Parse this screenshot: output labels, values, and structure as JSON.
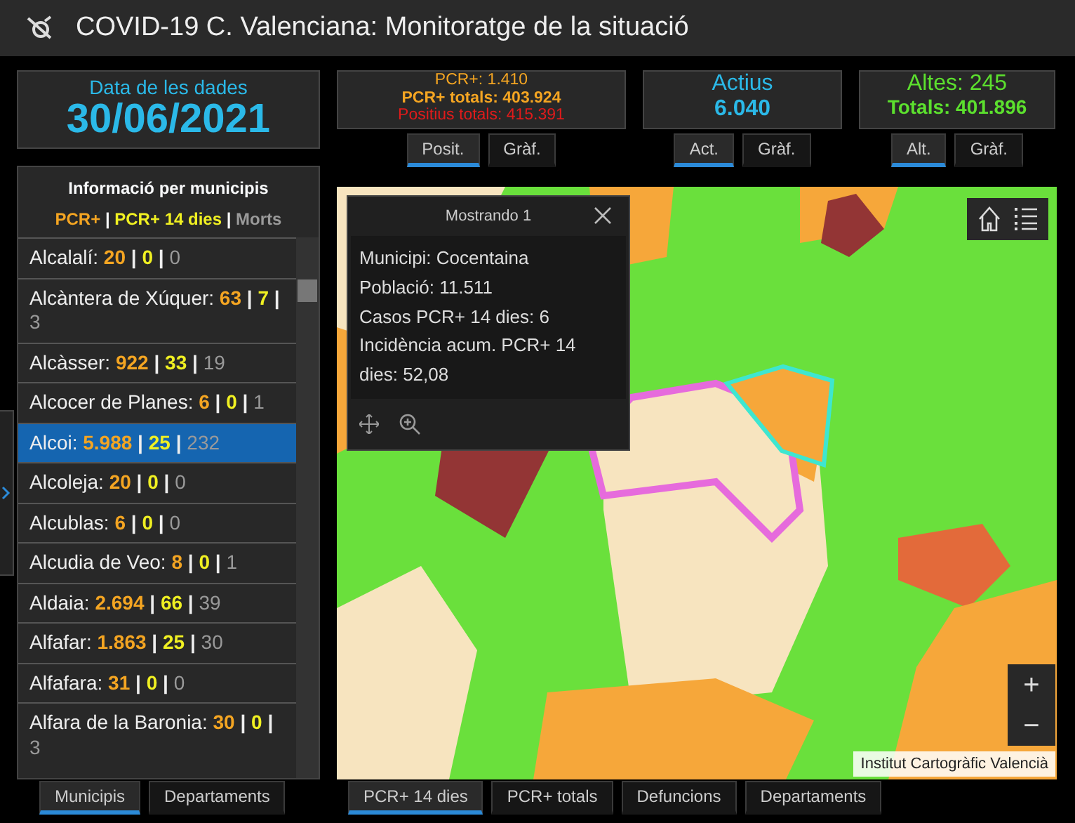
{
  "header": {
    "title": "COVID-19 C. Valenciana: Monitoratge de la situació"
  },
  "date_card": {
    "label": "Data de les dades",
    "value": "30/06/2021"
  },
  "pcr_card": {
    "lines": [
      {
        "text": "PCR+: 1.410",
        "kind": "pcr"
      },
      {
        "text": "PCR+ totals: 403.924",
        "kind": "total"
      },
      {
        "text": "Positius totals: 415.391",
        "kind": "positius"
      }
    ],
    "tabs": [
      {
        "label": "Posit.",
        "selected": true
      },
      {
        "label": "Gràf.",
        "selected": false
      }
    ]
  },
  "actius_card": {
    "label": "Actius",
    "value": "6.040",
    "tabs": [
      {
        "label": "Act.",
        "selected": true
      },
      {
        "label": "Gràf.",
        "selected": false
      }
    ]
  },
  "altes_card": {
    "label": "Altes: 245",
    "value": "Totals: 401.896",
    "tabs": [
      {
        "label": "Alt.",
        "selected": true
      },
      {
        "label": "Gràf.",
        "selected": false
      }
    ]
  },
  "municipis": {
    "title": "Informació per municipis",
    "separator": "|",
    "legend": [
      {
        "text": "PCR+",
        "kind": "pcr"
      },
      {
        "text": "PCR+ 14 dies",
        "kind": "pcr14"
      },
      {
        "text": "Morts",
        "kind": "morts"
      }
    ],
    "rows": [
      {
        "name": "Alcalalí:",
        "pcr": "20",
        "pcr14": "0",
        "morts": "0",
        "selected": false
      },
      {
        "name": "Alcàntera de Xúquer:",
        "pcr": "63",
        "pcr14": "7",
        "morts": "3",
        "selected": false
      },
      {
        "name": "Alcàsser:",
        "pcr": "922",
        "pcr14": "33",
        "morts": "19",
        "selected": false
      },
      {
        "name": "Alcocer de Planes:",
        "pcr": "6",
        "pcr14": "0",
        "morts": "1",
        "selected": false
      },
      {
        "name": "Alcoi:",
        "pcr": "5.988",
        "pcr14": "25",
        "morts": "232",
        "selected": true
      },
      {
        "name": "Alcoleja:",
        "pcr": "20",
        "pcr14": "0",
        "morts": "0",
        "selected": false
      },
      {
        "name": "Alcublas:",
        "pcr": "6",
        "pcr14": "0",
        "morts": "0",
        "selected": false
      },
      {
        "name": "Alcudia de Veo:",
        "pcr": "8",
        "pcr14": "0",
        "morts": "1",
        "selected": false
      },
      {
        "name": "Aldaia:",
        "pcr": "2.694",
        "pcr14": "66",
        "morts": "39",
        "selected": false
      },
      {
        "name": "Alfafar:",
        "pcr": "1.863",
        "pcr14": "25",
        "morts": "30",
        "selected": false
      },
      {
        "name": "Alfafara:",
        "pcr": "31",
        "pcr14": "0",
        "morts": "0",
        "selected": false
      },
      {
        "name": "Alfara de la Baronia:",
        "pcr": "30",
        "pcr14": "0",
        "morts": "3",
        "selected": false
      }
    ],
    "tabs": [
      {
        "label": "Municipis",
        "selected": true
      },
      {
        "label": "Departaments",
        "selected": false
      }
    ]
  },
  "map": {
    "popup": {
      "title": "Mostrando 1",
      "lines": [
        "Municipi: Cocentaina",
        "Població: 11.511",
        "Casos PCR+ 14 dies: 6",
        "Incidència acum. PCR+ 14 dies: 52,08"
      ]
    },
    "zoom_in": "+",
    "zoom_out": "−",
    "attribution": "Institut Cartogràfic Valencià",
    "tabs": [
      {
        "label": "PCR+ 14 dies",
        "selected": true
      },
      {
        "label": "PCR+ totals",
        "selected": false
      },
      {
        "label": "Defuncions",
        "selected": false
      },
      {
        "label": "Departaments",
        "selected": false
      }
    ]
  }
}
